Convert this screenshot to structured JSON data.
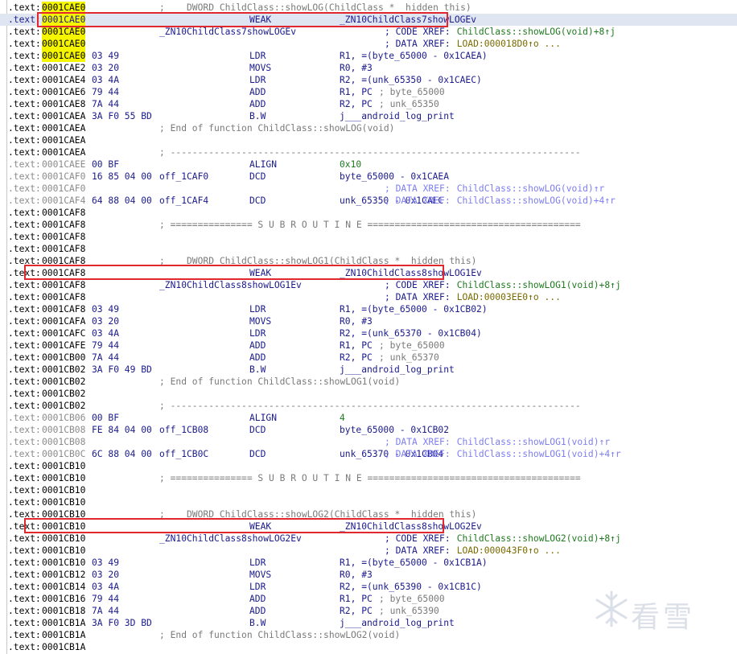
{
  "lines": [
    {
      "addr": "0001CAE0",
      "cmt": ";  __DWORD ChildClass::showLOG(ChildClass *__hidden this)",
      "hl": true
    },
    {
      "addr": "0001CAE0",
      "mnem": "WEAK",
      "ops": "_ZN10ChildClass7showLOGEv",
      "hl": true,
      "sel": true
    },
    {
      "addr": "0001CAE0",
      "loc": "_ZN10ChildClass7showLOGEv",
      "xp": "; CODE XREF: ",
      "xt": "ChildClass::showLOG(void)+8↑j",
      "hl": true
    },
    {
      "addr": "0001CAE0",
      "xp": "; DATA XREF: ",
      "xt": "LOAD:000018D0↑o ...",
      "xc": "brown",
      "hl": true
    },
    {
      "addr": "0001CAE0",
      "bytes": "03 49",
      "mnem": "LDR",
      "ops": "R1, =(byte_65000 - 0x1CAEA)",
      "hl": true
    },
    {
      "addr": "0001CAE2",
      "bytes": "03 20",
      "mnem": "MOVS",
      "ops": "R0, #3"
    },
    {
      "addr": "0001CAE4",
      "bytes": "03 4A",
      "mnem": "LDR",
      "ops": "R2, =(unk_65350 - 0x1CAEC)"
    },
    {
      "addr": "0001CAE6",
      "bytes": "79 44",
      "mnem": "ADD",
      "ops": "R1, PC",
      "oc": "; byte_65000"
    },
    {
      "addr": "0001CAE8",
      "bytes": "7A 44",
      "mnem": "ADD",
      "ops": "R2, PC",
      "oc": "; unk_65350"
    },
    {
      "addr": "0001CAEA",
      "bytes": "3A F0 55 BD",
      "mnem": "B.W",
      "ops": "j___android_log_print"
    },
    {
      "addr": "0001CAEA",
      "cmt": "; End of function ChildClass::showLOG(void)"
    },
    {
      "addr": "0001CAEA"
    },
    {
      "addr": "0001CAEA",
      "cmt": "; ---------------------------------------------------------------------------"
    },
    {
      "addr": "0001CAEE",
      "bytes": "00 BF",
      "mnem": "ALIGN",
      "ops": "0x10",
      "dim": true
    },
    {
      "addr": "0001CAF0",
      "bytes": "16 85 04 00",
      "loc": "off_1CAF0",
      "mnem": "DCD",
      "ops": "byte_65000 - 0x1CAEA",
      "dim": true
    },
    {
      "addr": "0001CAF0",
      "xp": "; DATA XREF: ",
      "xt": "ChildClass::showLOG(void)↑r",
      "xc": "lblue",
      "dim": true
    },
    {
      "addr": "0001CAF4",
      "bytes": "64 88 04 00",
      "loc": "off_1CAF4",
      "mnem": "DCD",
      "ops": "unk_65350 - 0x1CAEC",
      "xp": "; DATA XREF: ",
      "xt": "ChildClass::showLOG(void)+4↑r",
      "xc": "lblue",
      "dim": true
    },
    {
      "addr": "0001CAF8"
    },
    {
      "addr": "0001CAF8",
      "cmt": "; =============== S U B R O U T I N E ======================================="
    },
    {
      "addr": "0001CAF8"
    },
    {
      "addr": "0001CAF8"
    },
    {
      "addr": "0001CAF8",
      "cmt": ";  __DWORD ChildClass::showLOG1(ChildClass *__hidden this)"
    },
    {
      "addr": "0001CAF8",
      "mnem": "WEAK",
      "ops": "_ZN10ChildClass8showLOG1Ev"
    },
    {
      "addr": "0001CAF8",
      "loc": "_ZN10ChildClass8showLOG1Ev",
      "xp": "; CODE XREF: ",
      "xt": "ChildClass::showLOG1(void)+8↑j"
    },
    {
      "addr": "0001CAF8",
      "xp": "; DATA XREF: ",
      "xt": "LOAD:00003EE0↑o ...",
      "xc": "brown"
    },
    {
      "addr": "0001CAF8",
      "bytes": "03 49",
      "mnem": "LDR",
      "ops": "R1, =(byte_65000 - 0x1CB02)"
    },
    {
      "addr": "0001CAFA",
      "bytes": "03 20",
      "mnem": "MOVS",
      "ops": "R0, #3"
    },
    {
      "addr": "0001CAFC",
      "bytes": "03 4A",
      "mnem": "LDR",
      "ops": "R2, =(unk_65370 - 0x1CB04)"
    },
    {
      "addr": "0001CAFE",
      "bytes": "79 44",
      "mnem": "ADD",
      "ops": "R1, PC",
      "oc": "; byte_65000"
    },
    {
      "addr": "0001CB00",
      "bytes": "7A 44",
      "mnem": "ADD",
      "ops": "R2, PC",
      "oc": "; unk_65370"
    },
    {
      "addr": "0001CB02",
      "bytes": "3A F0 49 BD",
      "mnem": "B.W",
      "ops": "j___android_log_print"
    },
    {
      "addr": "0001CB02",
      "cmt": "; End of function ChildClass::showLOG1(void)"
    },
    {
      "addr": "0001CB02"
    },
    {
      "addr": "0001CB02",
      "cmt": "; ---------------------------------------------------------------------------"
    },
    {
      "addr": "0001CB06",
      "bytes": "00 BF",
      "mnem": "ALIGN",
      "ops": "4",
      "dim": true
    },
    {
      "addr": "0001CB08",
      "bytes": "FE 84 04 00",
      "loc": "off_1CB08",
      "mnem": "DCD",
      "ops": "byte_65000 - 0x1CB02",
      "dim": true
    },
    {
      "addr": "0001CB08",
      "xp": "; DATA XREF: ",
      "xt": "ChildClass::showLOG1(void)↑r",
      "xc": "lblue",
      "dim": true
    },
    {
      "addr": "0001CB0C",
      "bytes": "6C 88 04 00",
      "loc": "off_1CB0C",
      "mnem": "DCD",
      "ops": "unk_65370 - 0x1CB04",
      "xp": "; DATA XREF: ",
      "xt": "ChildClass::showLOG1(void)+4↑r",
      "xc": "lblue",
      "dim": true
    },
    {
      "addr": "0001CB10"
    },
    {
      "addr": "0001CB10",
      "cmt": "; =============== S U B R O U T I N E ======================================="
    },
    {
      "addr": "0001CB10"
    },
    {
      "addr": "0001CB10"
    },
    {
      "addr": "0001CB10",
      "cmt": ";  __DWORD ChildClass::showLOG2(ChildClass *__hidden this)"
    },
    {
      "addr": "0001CB10",
      "mnem": "WEAK",
      "ops": "_ZN10ChildClass8showLOG2Ev"
    },
    {
      "addr": "0001CB10",
      "loc": "_ZN10ChildClass8showLOG2Ev",
      "xp": "; CODE XREF: ",
      "xt": "ChildClass::showLOG2(void)+8↑j"
    },
    {
      "addr": "0001CB10",
      "xp": "; DATA XREF: ",
      "xt": "LOAD:000043F0↑o ...",
      "xc": "brown"
    },
    {
      "addr": "0001CB10",
      "bytes": "03 49",
      "mnem": "LDR",
      "ops": "R1, =(byte_65000 - 0x1CB1A)"
    },
    {
      "addr": "0001CB12",
      "bytes": "03 20",
      "mnem": "MOVS",
      "ops": "R0, #3"
    },
    {
      "addr": "0001CB14",
      "bytes": "03 4A",
      "mnem": "LDR",
      "ops": "R2, =(unk_65390 - 0x1CB1C)"
    },
    {
      "addr": "0001CB16",
      "bytes": "79 44",
      "mnem": "ADD",
      "ops": "R1, PC",
      "oc": "; byte_65000"
    },
    {
      "addr": "0001CB18",
      "bytes": "7A 44",
      "mnem": "ADD",
      "ops": "R2, PC",
      "oc": "; unk_65390"
    },
    {
      "addr": "0001CB1A",
      "bytes": "3A F0 3D BD",
      "mnem": "B.W",
      "ops": "j___android_log_print"
    },
    {
      "addr": "0001CB1A",
      "cmt": "; End of function ChildClass::showLOG2(void)"
    },
    {
      "addr": "0001CB1A"
    }
  ],
  "prefix": ".text:",
  "watermark": {
    "text": "看雪",
    "icon": "snowflake-icon"
  },
  "colors": {
    "highlight": "#f5f500",
    "box": "#e0282e",
    "code_green": "#1f7a1f",
    "xref_brown": "#7a6a00",
    "xref_lightblue": "#7e7ef0"
  }
}
